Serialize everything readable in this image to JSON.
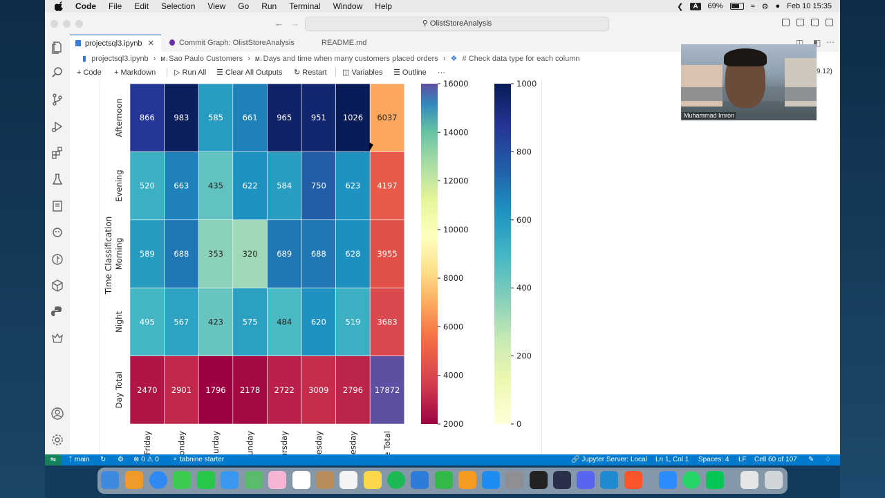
{
  "menubar": {
    "app": "Code",
    "items": [
      "File",
      "Edit",
      "Selection",
      "View",
      "Go",
      "Run",
      "Terminal",
      "Window",
      "Help"
    ],
    "input_indicator": "A",
    "battery": "69%",
    "datetime": "Feb 10  15:35"
  },
  "titlebar": {
    "search": "OlistStoreAnalysis"
  },
  "tabs": [
    {
      "label": "projectsql3.ipynb",
      "active": true
    },
    {
      "label": "Commit Graph: OlistStoreAnalysis",
      "active": false
    },
    {
      "label": "README.md",
      "active": false
    }
  ],
  "breadcrumb": [
    "projectsql3.ipynb",
    "Sao Paulo Customers",
    "Days and time when many customers placed orders",
    "# Check data type for each column"
  ],
  "breadcrumb_markers": [
    "M↓",
    "M↓"
  ],
  "toolbar": {
    "code": "Code",
    "markdown": "Markdown",
    "run_all": "Run All",
    "clear": "Clear All Outputs",
    "restart": "Restart",
    "variables": "Variables",
    "outline": "Outline",
    "more": "···"
  },
  "python_version": "9.12)",
  "video": {
    "name": "Muhammad Imron"
  },
  "status": {
    "branch": "main",
    "problems": "0",
    "warnings": "0",
    "tabnine": "tabnine starter",
    "jupyter": "Jupyter Server: Local",
    "position": "Ln 1, Col 1",
    "spaces": "Spaces: 4",
    "eol": "LF",
    "cell": "Cell 60 of 107"
  },
  "chart_data": {
    "type": "heatmap",
    "ylabel": "Time Classification",
    "rows": [
      "Afternoon",
      "Evening",
      "Morning",
      "Night",
      "Day Total"
    ],
    "columns_visible": [
      "Friday",
      "onday",
      "urday",
      "unday",
      "ursday",
      "esday",
      "esday",
      "e Total"
    ],
    "values": [
      [
        866,
        983,
        585,
        661,
        965,
        951,
        1026,
        6037
      ],
      [
        520,
        663,
        435,
        622,
        584,
        750,
        623,
        4197
      ],
      [
        589,
        688,
        353,
        320,
        689,
        688,
        628,
        3955
      ],
      [
        495,
        567,
        423,
        575,
        484,
        620,
        519,
        3683
      ],
      [
        2470,
        2901,
        1796,
        2178,
        2722,
        3009,
        2796,
        17872
      ]
    ],
    "colorbar_spectral": {
      "ticks": [
        16000,
        14000,
        12000,
        10000,
        8000,
        6000,
        4000,
        2000
      ],
      "range": [
        2000,
        16000
      ]
    },
    "colorbar_ylgnbu": {
      "ticks": [
        1000,
        800,
        600,
        400,
        200,
        0
      ],
      "range": [
        0,
        1000
      ]
    }
  }
}
